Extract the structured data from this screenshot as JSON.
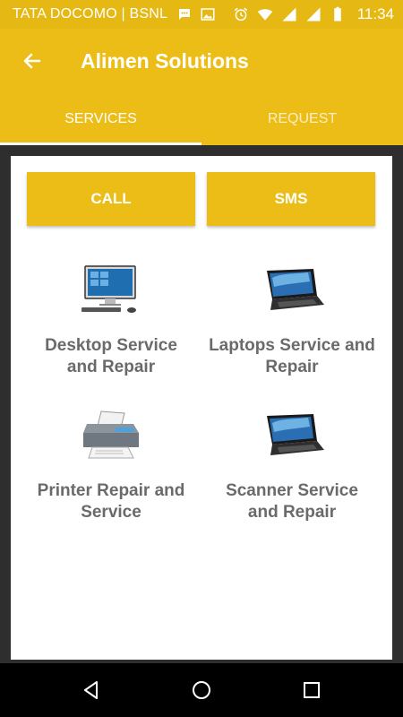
{
  "status_bar": {
    "carrier": "TATA DOCOMO | BSNL",
    "time": "11:34",
    "icons": [
      "chat-notification-icon",
      "image-icon",
      "alarm-icon",
      "wifi-icon",
      "signal-icon",
      "signal-icon",
      "battery-icon"
    ]
  },
  "app_bar": {
    "title": "Alimen Solutions",
    "back_icon": "arrow-left-icon"
  },
  "tabs": [
    {
      "label": "SERVICES",
      "active": true
    },
    {
      "label": "REQUEST",
      "active": false
    }
  ],
  "actions": {
    "call_label": "CALL",
    "sms_label": "SMS"
  },
  "services": [
    {
      "label": "Desktop Service\nand Repair",
      "icon": "desktop-computer-icon"
    },
    {
      "label": "Laptops Service and\nRepair",
      "icon": "laptop-icon"
    },
    {
      "label": "Printer  Repair and\nService",
      "icon": "printer-icon"
    },
    {
      "label": "Scanner Service\nand Repair",
      "icon": "laptop-icon"
    }
  ],
  "nav_bar": {
    "icons": [
      "back-triangle-icon",
      "home-circle-icon",
      "recents-square-icon"
    ]
  },
  "colors": {
    "accent": "#ecbd16",
    "status_bar": "#e6b813",
    "label_text": "#6a6a6a"
  }
}
